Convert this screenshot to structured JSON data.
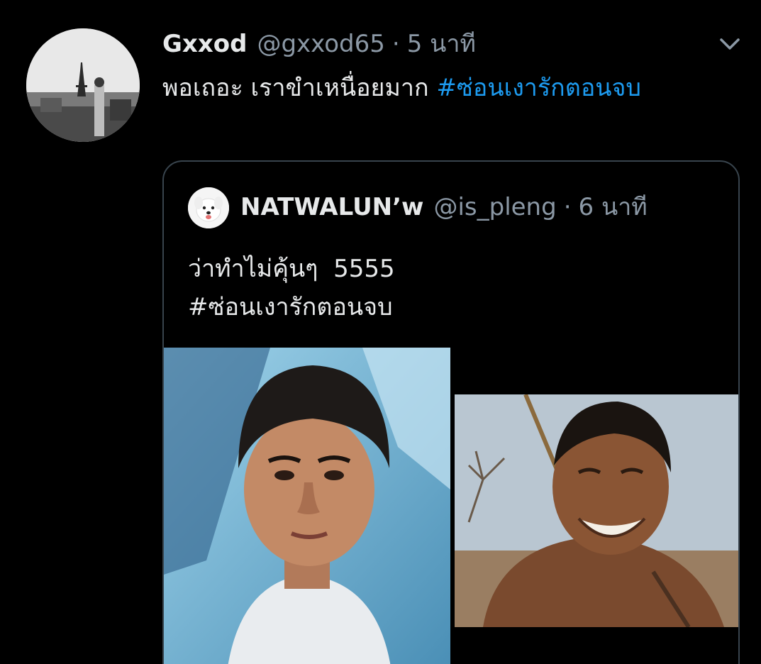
{
  "tweet": {
    "display_name": "Gxxod",
    "handle": "@gxxod65",
    "separator": "·",
    "time": "5 นาที",
    "text": "พอเถอะ เราขำเหนื่อยมาก ",
    "hashtag": "#ซ่อนเงารักตอนจบ",
    "avatar_icon": "avatar-eiffel-photo",
    "menu_icon": "chevron-down-icon"
  },
  "quote": {
    "display_name": "NATWALUN’w",
    "handle": "@is_pleng",
    "separator": "·",
    "time": "6 นาที",
    "text": "ว่าทำไม่คุ้นๆ  5555\n#ซ่อนเงารักตอนจบ",
    "avatar_icon": "avatar-dog-photo",
    "images": [
      "photo-woman-short-hair",
      "photo-smiling-man"
    ]
  },
  "colors": {
    "background": "#000000",
    "text": "#e7e9ea",
    "secondary": "#8b98a5",
    "link": "#1d9bf0",
    "border": "#38444d"
  }
}
